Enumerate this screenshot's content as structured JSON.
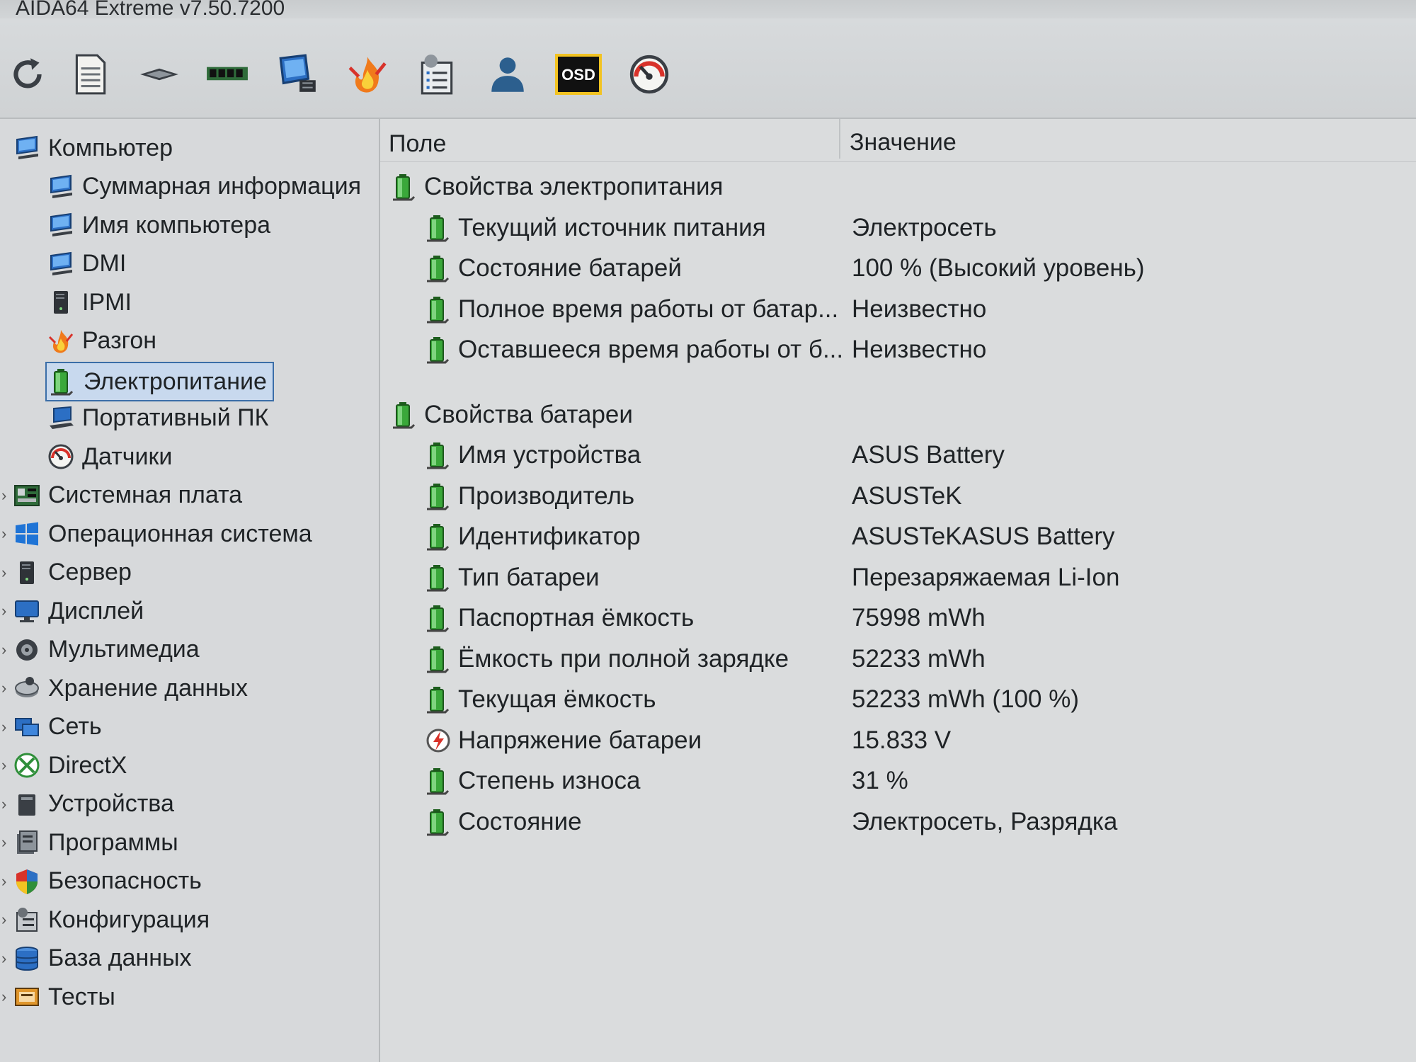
{
  "window": {
    "title": "AIDA64 Extreme v7.50.7200"
  },
  "toolbar": {
    "buttons": [
      {
        "name": "refresh-button",
        "icon": "refresh-icon"
      },
      {
        "name": "report-button",
        "icon": "report-icon"
      },
      {
        "name": "bios-update-button",
        "icon": "chip-icon"
      },
      {
        "name": "memory-button",
        "icon": "memory-icon"
      },
      {
        "name": "network-audit-button",
        "icon": "network-computer-icon"
      },
      {
        "name": "stress-test-button",
        "icon": "flame-icon"
      },
      {
        "name": "preferences-button",
        "icon": "checklist-icon"
      },
      {
        "name": "user-button",
        "icon": "user-icon"
      },
      {
        "name": "osd-button",
        "icon": "osd-icon",
        "label": "OSD"
      },
      {
        "name": "sensor-panel-button",
        "icon": "gauge-icon"
      }
    ]
  },
  "sidebar": {
    "items": [
      {
        "label": "Компьютер",
        "icon": "computer-icon",
        "level": 0
      },
      {
        "label": "Суммарная информация",
        "icon": "computer-icon",
        "level": 1
      },
      {
        "label": "Имя компьютера",
        "icon": "computer-icon",
        "level": 1
      },
      {
        "label": "DMI",
        "icon": "computer-icon",
        "level": 1
      },
      {
        "label": "IPMI",
        "icon": "server-icon",
        "level": 1
      },
      {
        "label": "Разгон",
        "icon": "flame-icon",
        "level": 1
      },
      {
        "label": "Электропитание",
        "icon": "battery-icon",
        "level": 1,
        "selected": true
      },
      {
        "label": "Портативный ПК",
        "icon": "laptop-icon",
        "level": 1
      },
      {
        "label": "Датчики",
        "icon": "gauge-icon",
        "level": 1
      },
      {
        "label": "Системная плата",
        "icon": "motherboard-icon",
        "level": 0
      },
      {
        "label": "Операционная система",
        "icon": "windows-icon",
        "level": 0
      },
      {
        "label": "Сервер",
        "icon": "server-icon",
        "level": 0
      },
      {
        "label": "Дисплей",
        "icon": "monitor-icon",
        "level": 0
      },
      {
        "label": "Мультимедиа",
        "icon": "speaker-icon",
        "level": 0
      },
      {
        "label": "Хранение данных",
        "icon": "disk-icon",
        "level": 0
      },
      {
        "label": "Сеть",
        "icon": "network-icon",
        "level": 0
      },
      {
        "label": "DirectX",
        "icon": "xbox-icon",
        "level": 0
      },
      {
        "label": "Устройства",
        "icon": "device-icon",
        "level": 0
      },
      {
        "label": "Программы",
        "icon": "programs-icon",
        "level": 0
      },
      {
        "label": "Безопасность",
        "icon": "shield-icon",
        "level": 0
      },
      {
        "label": "Конфигурация",
        "icon": "config-icon",
        "level": 0
      },
      {
        "label": "База данных",
        "icon": "database-icon",
        "level": 0
      },
      {
        "label": "Тесты",
        "icon": "benchmark-icon",
        "level": 0
      }
    ]
  },
  "content": {
    "columns": {
      "field": "Поле",
      "value": "Значение"
    },
    "rows": [
      {
        "field": "Свойства электропитания",
        "value": "",
        "level": 0,
        "icon": "battery-icon"
      },
      {
        "field": "Текущий источник питания",
        "value": "Электросеть",
        "level": 1,
        "icon": "battery-icon"
      },
      {
        "field": "Состояние батарей",
        "value": "100 % (Высокий уровень)",
        "level": 1,
        "icon": "battery-icon"
      },
      {
        "field": "Полное время работы от батар...",
        "value": "Неизвестно",
        "level": 1,
        "icon": "battery-icon"
      },
      {
        "field": "Оставшееся время работы от б...",
        "value": "Неизвестно",
        "level": 1,
        "icon": "battery-icon"
      },
      {
        "field": "Свойства батареи",
        "value": "",
        "level": 0,
        "icon": "battery-icon",
        "gap": true
      },
      {
        "field": "Имя устройства",
        "value": "ASUS Battery",
        "level": 1,
        "icon": "battery-icon"
      },
      {
        "field": "Производитель",
        "value": "ASUSTeK",
        "level": 1,
        "icon": "battery-icon"
      },
      {
        "field": "Идентификатор",
        "value": "ASUSTeKASUS Battery",
        "level": 1,
        "icon": "battery-icon"
      },
      {
        "field": "Тип батареи",
        "value": "Перезаряжаемая Li-Ion",
        "level": 1,
        "icon": "battery-icon"
      },
      {
        "field": "Паспортная ёмкость",
        "value": "75998 mWh",
        "level": 1,
        "icon": "battery-icon"
      },
      {
        "field": "Ёмкость при полной зарядке",
        "value": "52233 mWh",
        "level": 1,
        "icon": "battery-icon"
      },
      {
        "field": "Текущая ёмкость",
        "value": "52233 mWh  (100 %)",
        "level": 1,
        "icon": "battery-icon"
      },
      {
        "field": "Напряжение батареи",
        "value": "15.833 V",
        "level": 1,
        "icon": "voltage-icon"
      },
      {
        "field": "Степень износа",
        "value": "31 %",
        "level": 1,
        "icon": "battery-icon"
      },
      {
        "field": "Состояние",
        "value": "Электросеть, Разрядка",
        "level": 1,
        "icon": "battery-icon"
      }
    ]
  },
  "colors": {
    "selection_bg": "#c8d9ee",
    "selection_border": "#3b6ea8",
    "battery_green": "#2f9e2f",
    "accent_red": "#d8322a"
  }
}
